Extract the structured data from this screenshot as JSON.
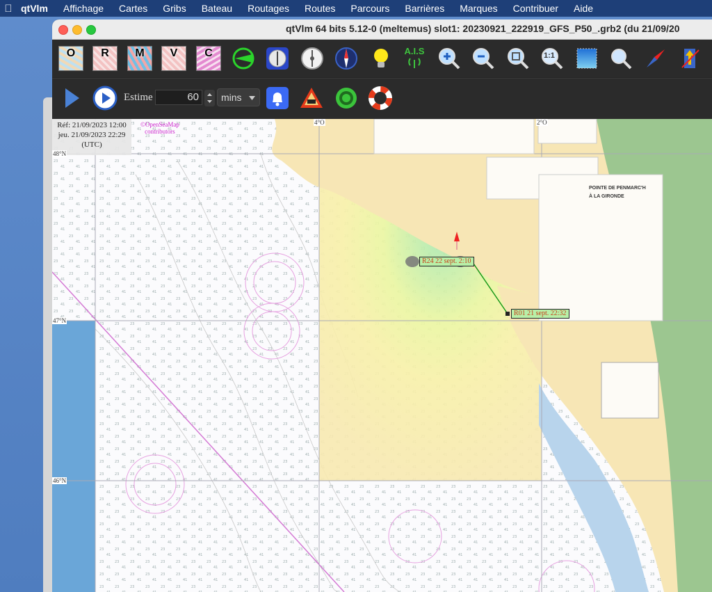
{
  "menubar": {
    "app": "qtVlm",
    "items": [
      "Affichage",
      "Cartes",
      "Gribs",
      "Bateau",
      "Routages",
      "Routes",
      "Parcours",
      "Barrières",
      "Marques",
      "Contribuer",
      "Aide"
    ]
  },
  "window": {
    "title": "qtVlm 64 bits 5.12-0 (meltemus) slot1: 20230921_222919_GFS_P50_.grb2 (du 21/09/20"
  },
  "toolbar1": {
    "map_buttons": [
      "O",
      "R",
      "M",
      "V",
      "C"
    ],
    "ais_label": "A.I.S",
    "zoom_1_1_label": "1:1"
  },
  "toolbar2": {
    "estime_label": "Estime",
    "estime_value": "60",
    "estime_unit": "mins"
  },
  "map": {
    "info": {
      "ref_line": "Réf: 21/09/2023 12:00",
      "date_line": "jeu. 21/09/2023 22:29",
      "tz": "(UTC)"
    },
    "attribution_line1": "©OpenSeaMap",
    "attribution_line2": "contributors",
    "lat_labels": [
      "48°N",
      "47°N",
      "46°N"
    ],
    "lon_labels": [
      "4°O",
      "2°O"
    ],
    "route_label_1": "R24 22 sept. 2:10",
    "route_label_2": "R01 21 sept. 22:32",
    "inset_title_1": "POINTE DE PENMARC'H",
    "inset_title_2": "À LA GIRONDE"
  },
  "colors": {
    "menubar_bg": "#1e3f78",
    "toolbar_bg": "#2b2b2b",
    "land": "#f7e6b5",
    "route_line": "#1a9a1a",
    "label_bg": "#b8f0a8"
  }
}
